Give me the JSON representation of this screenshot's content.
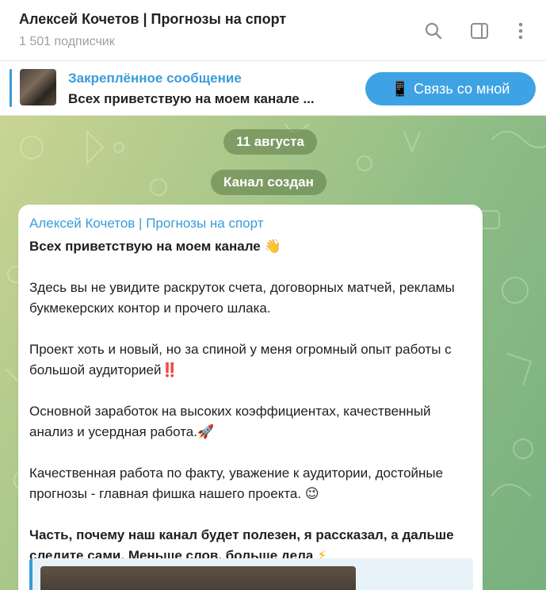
{
  "header": {
    "title": "Алексей Кочетов | Прогнозы на спорт",
    "subscribers": "1 501 подписчик"
  },
  "pinned": {
    "title": "Закреплённое сообщение",
    "text": "Всех приветствую на моем канале ...",
    "button_icon": "📱",
    "button_label": "Связь со мной"
  },
  "chat": {
    "date_label": "11 августа",
    "service_message": "Канал создан",
    "post": {
      "author": "Алексей Кочетов | Прогнозы на спорт",
      "line1": "Всех приветствую на моем канале",
      "line1_emoji": "👋",
      "para1": "Здесь вы не увидите раскруток счета, договорных матчей, рекламы букмекерских контор и прочего шлака.",
      "para2": "Проект хоть и новый, но за спиной у меня огромный опыт работы с большой аудиторией",
      "para2_emoji": "‼️",
      "para3": "Основной заработок на высоких коэффициентах, качественный анализ и усердная работа.",
      "para3_emoji": "🚀",
      "para4": "Качественная работа по факту, уважение к аудитории, достойные прогнозы - главная фишка нашего проекта.",
      "para4_emoji": "😉",
      "para5": "Часть, почему наш канал будет полезен, я рассказал, а дальше следите сами. Меньше слов, больше дела",
      "para5_emoji": "⚡"
    }
  },
  "colors": {
    "accent": "#3a9bd9",
    "button": "#3ea3e4"
  },
  "icons": [
    "search-icon",
    "sidebar-toggle-icon",
    "more-vertical-icon"
  ]
}
